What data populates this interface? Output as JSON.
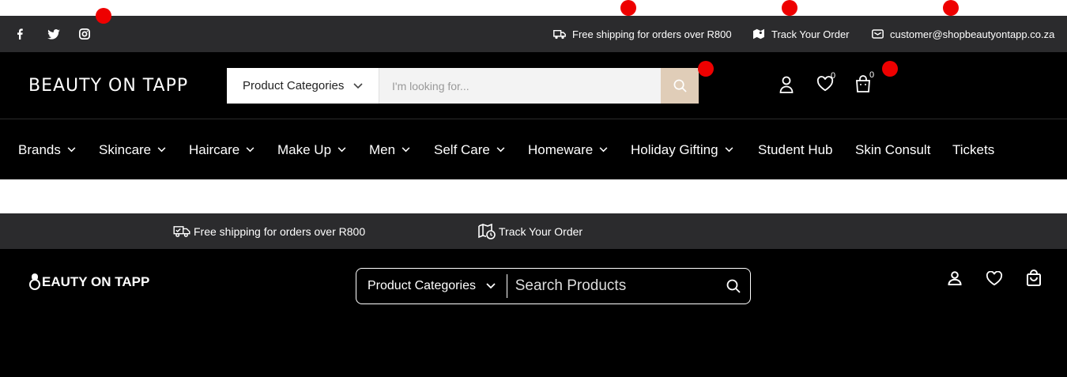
{
  "header_a": {
    "topbar": {
      "social": [
        "facebook-icon",
        "twitter-icon",
        "instagram-icon"
      ],
      "shipping": "Free shipping for orders over R800",
      "track": "Track Your Order",
      "email": "customer@shopbeautyontapp.co.za"
    },
    "logo": "BEAUTY ON TAPP",
    "search": {
      "category_label": "Product Categories",
      "placeholder": "I'm looking for..."
    },
    "wishlist_count": "0",
    "cart_count": "0",
    "nav": [
      {
        "label": "Brands",
        "dropdown": true
      },
      {
        "label": "Skincare",
        "dropdown": true
      },
      {
        "label": "Haircare",
        "dropdown": true
      },
      {
        "label": "Make Up",
        "dropdown": true
      },
      {
        "label": "Men",
        "dropdown": true
      },
      {
        "label": "Self Care",
        "dropdown": true
      },
      {
        "label": "Homeware",
        "dropdown": true
      },
      {
        "label": "Holiday Gifting",
        "dropdown": true
      },
      {
        "label": "Student Hub",
        "dropdown": false
      },
      {
        "label": "Skin Consult",
        "dropdown": false
      },
      {
        "label": "Tickets",
        "dropdown": false
      }
    ]
  },
  "header_b": {
    "topbar": {
      "shipping": "Free shipping for orders over R800",
      "track": "Track Your Order"
    },
    "logo": "EAUTY ON TAPP",
    "search": {
      "category_label": "Product Categories",
      "placeholder": "Search Products"
    }
  },
  "colors": {
    "topbar_bg": "#2b2b2d",
    "header_bg": "#000000",
    "search_button_bg": "#e0cdb8",
    "marker": "#ee0000"
  }
}
